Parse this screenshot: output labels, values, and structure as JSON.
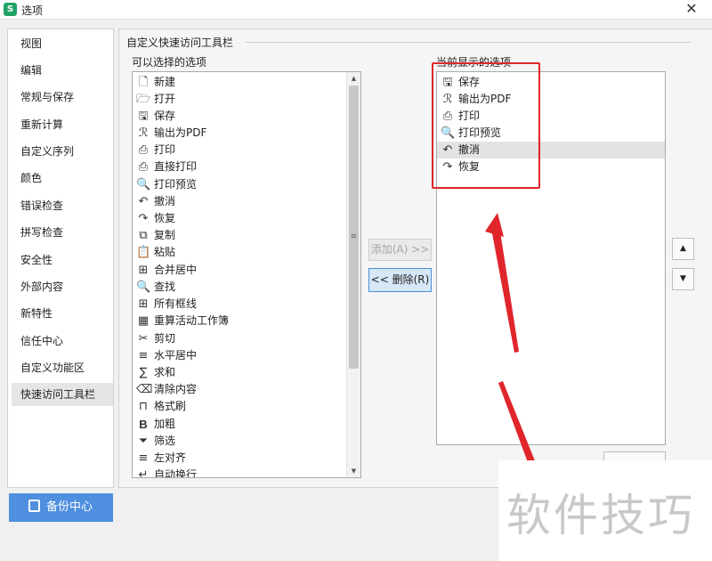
{
  "window": {
    "title": "选项",
    "app_icon_text": "S"
  },
  "sidebar": {
    "items": [
      {
        "label": "视图"
      },
      {
        "label": "编辑"
      },
      {
        "label": "常规与保存"
      },
      {
        "label": "重新计算"
      },
      {
        "label": "自定义序列"
      },
      {
        "label": "颜色"
      },
      {
        "label": "错误检查"
      },
      {
        "label": "拼写检查"
      },
      {
        "label": "安全性"
      },
      {
        "label": "外部内容"
      },
      {
        "label": "新特性"
      },
      {
        "label": "信任中心"
      },
      {
        "label": "自定义功能区"
      },
      {
        "label": "快速访问工具栏"
      }
    ],
    "active_label": "快速访问工具栏",
    "backup_label": "备份中心"
  },
  "main": {
    "section_title": "自定义快速访问工具栏",
    "available": {
      "label": "可以选择的选项",
      "items": [
        {
          "label": "新建",
          "icon": "new-file-icon",
          "glyph": "🗋"
        },
        {
          "label": "打开",
          "icon": "open-folder-icon",
          "glyph": "🗁"
        },
        {
          "label": "保存",
          "icon": "save-icon",
          "glyph": "🖫"
        },
        {
          "label": "输出为PDF",
          "icon": "export-pdf-icon",
          "glyph": "ℛ"
        },
        {
          "label": "打印",
          "icon": "print-icon",
          "glyph": "⎙"
        },
        {
          "label": "直接打印",
          "icon": "direct-print-icon",
          "glyph": "⎙"
        },
        {
          "label": "打印预览",
          "icon": "print-preview-icon",
          "glyph": "🔍"
        },
        {
          "label": "撤消",
          "icon": "undo-icon",
          "glyph": "↶"
        },
        {
          "label": "恢复",
          "icon": "redo-icon",
          "glyph": "↷"
        },
        {
          "label": "复制",
          "icon": "copy-icon",
          "glyph": "⧉"
        },
        {
          "label": "粘贴",
          "icon": "paste-icon",
          "glyph": "📋"
        },
        {
          "label": "合并居中",
          "icon": "merge-center-icon",
          "glyph": "⊞"
        },
        {
          "label": "查找",
          "icon": "find-icon",
          "glyph": "🔍"
        },
        {
          "label": "所有框线",
          "icon": "all-borders-icon",
          "glyph": "⊞"
        },
        {
          "label": "重算活动工作簿",
          "icon": "recalc-workbook-icon",
          "glyph": "▦"
        },
        {
          "label": "剪切",
          "icon": "cut-icon",
          "glyph": "✂"
        },
        {
          "label": "水平居中",
          "icon": "align-center-icon",
          "glyph": "≡"
        },
        {
          "label": "求和",
          "icon": "sum-icon",
          "glyph": "∑"
        },
        {
          "label": "清除内容",
          "icon": "clear-content-icon",
          "glyph": "⌫"
        },
        {
          "label": "格式刷",
          "icon": "format-painter-icon",
          "glyph": "⊓"
        },
        {
          "label": "加粗",
          "icon": "bold-icon",
          "glyph": "B"
        },
        {
          "label": "筛选",
          "icon": "filter-icon",
          "glyph": "⏷"
        },
        {
          "label": "左对齐",
          "icon": "align-left-icon",
          "glyph": "≡"
        },
        {
          "label": "自动换行",
          "icon": "wrap-text-icon",
          "glyph": "↵"
        }
      ]
    },
    "current": {
      "label": "当前显示的选项",
      "items": [
        {
          "label": "保存",
          "icon": "save-icon",
          "glyph": "🖫"
        },
        {
          "label": "输出为PDF",
          "icon": "export-pdf-icon",
          "glyph": "ℛ"
        },
        {
          "label": "打印",
          "icon": "print-icon",
          "glyph": "⎙"
        },
        {
          "label": "打印预览",
          "icon": "print-preview-icon",
          "glyph": "🔍"
        },
        {
          "label": "撤消",
          "icon": "undo-icon",
          "glyph": "↶"
        },
        {
          "label": "恢复",
          "icon": "redo-icon",
          "glyph": "↷"
        }
      ],
      "selected_label": "撤消"
    },
    "buttons": {
      "add": "添加(A) >>",
      "remove": "<< 删除(R)",
      "move_up_glyph": "▲",
      "move_down_glyph": "▼"
    }
  },
  "watermark": {
    "text": "软件技巧"
  },
  "colors": {
    "annotation": "#e0252b",
    "accent": "#4e8fe0",
    "selection": "#e3e3e3"
  }
}
